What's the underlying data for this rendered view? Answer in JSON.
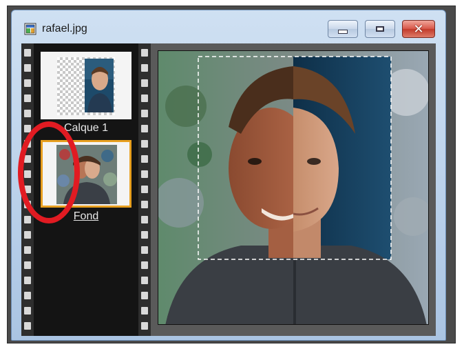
{
  "window": {
    "title": "rafael.jpg",
    "icon": "image-file-icon",
    "buttons": {
      "minimize": "minimize-icon",
      "maximize": "maximize-icon",
      "close_glyph": "✕"
    }
  },
  "layers": {
    "items": [
      {
        "label": "Calque 1",
        "selected": false
      },
      {
        "label": "Fond",
        "selected": true
      }
    ]
  },
  "colors": {
    "selection_border": "#e8a020",
    "annotation_circle": "#e11b22",
    "close_button": "#d9594b",
    "titlebar": "#b9d0ea"
  }
}
